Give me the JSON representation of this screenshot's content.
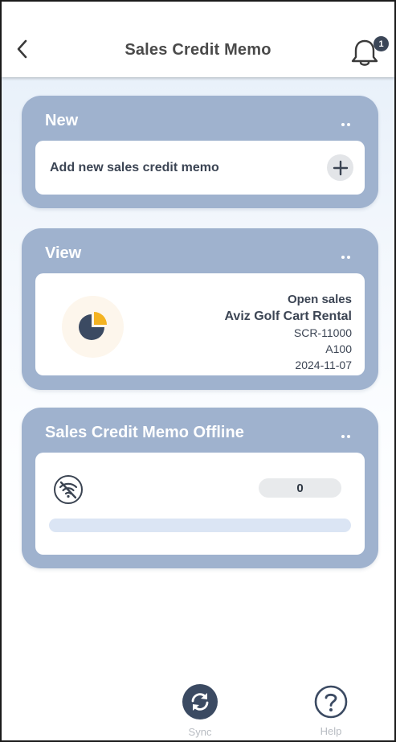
{
  "header": {
    "title": "Sales Credit Memo",
    "notification_count": "1"
  },
  "cards": {
    "new": {
      "title": "New",
      "add_label": "Add new sales credit memo"
    },
    "view": {
      "title": "View",
      "status": "Open sales",
      "customer": "Aviz Golf Cart Rental",
      "document_no": "SCR-11000",
      "code": "A100",
      "date": "2024-11-07"
    },
    "offline": {
      "title": "Sales Credit Memo Offline",
      "count": "0",
      "progress": 0
    }
  },
  "nav": {
    "sync_label": "Sync",
    "help_label": "Help"
  },
  "colors": {
    "card_bg": "#9fb2ce",
    "dark_navy": "#3b4a62",
    "accent_yellow": "#f4b321"
  },
  "icons": {
    "back": "chevron-left-icon",
    "bell": "bell-icon",
    "add": "plus-icon",
    "pie": "pie-chart-icon",
    "wifi_off": "wifi-off-icon",
    "sync": "sync-icon",
    "help": "help-icon"
  }
}
